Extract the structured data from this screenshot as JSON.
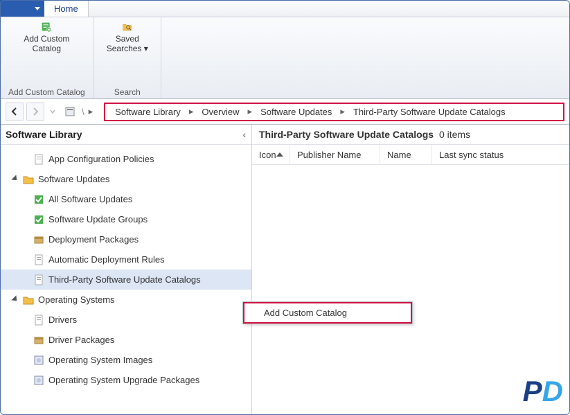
{
  "tab": {
    "home": "Home"
  },
  "ribbon": {
    "addCatalogBtn": "Add Custom\nCatalog",
    "addCatalogGroup": "Add Custom Catalog",
    "savedSearchesBtn": "Saved\nSearches ▾",
    "searchGroup": "Search"
  },
  "breadcrumb": {
    "items": [
      "Software Library",
      "Overview",
      "Software Updates",
      "Third-Party Software Update Catalogs"
    ],
    "sep": "›"
  },
  "sidebar": {
    "title": "Software Library",
    "items": [
      {
        "label": "App Configuration Policies",
        "level": 2
      },
      {
        "label": "Software Updates",
        "level": 1,
        "expanded": true
      },
      {
        "label": "All Software Updates",
        "level": 2
      },
      {
        "label": "Software Update Groups",
        "level": 2
      },
      {
        "label": "Deployment Packages",
        "level": 2
      },
      {
        "label": "Automatic Deployment Rules",
        "level": 2
      },
      {
        "label": "Third-Party Software Update Catalogs",
        "level": 2,
        "selected": true
      },
      {
        "label": "Operating Systems",
        "level": 1,
        "expanded": true
      },
      {
        "label": "Drivers",
        "level": 2
      },
      {
        "label": "Driver Packages",
        "level": 2
      },
      {
        "label": "Operating System Images",
        "level": 2
      },
      {
        "label": "Operating System Upgrade Packages",
        "level": 2
      }
    ]
  },
  "content": {
    "titleBold": "Third-Party Software Update Catalogs",
    "count": "0 items",
    "cols": {
      "icon": "Icon",
      "pub": "Publisher Name",
      "name": "Name",
      "sync": "Last sync status"
    }
  },
  "context": {
    "add": "Add Custom Catalog"
  }
}
